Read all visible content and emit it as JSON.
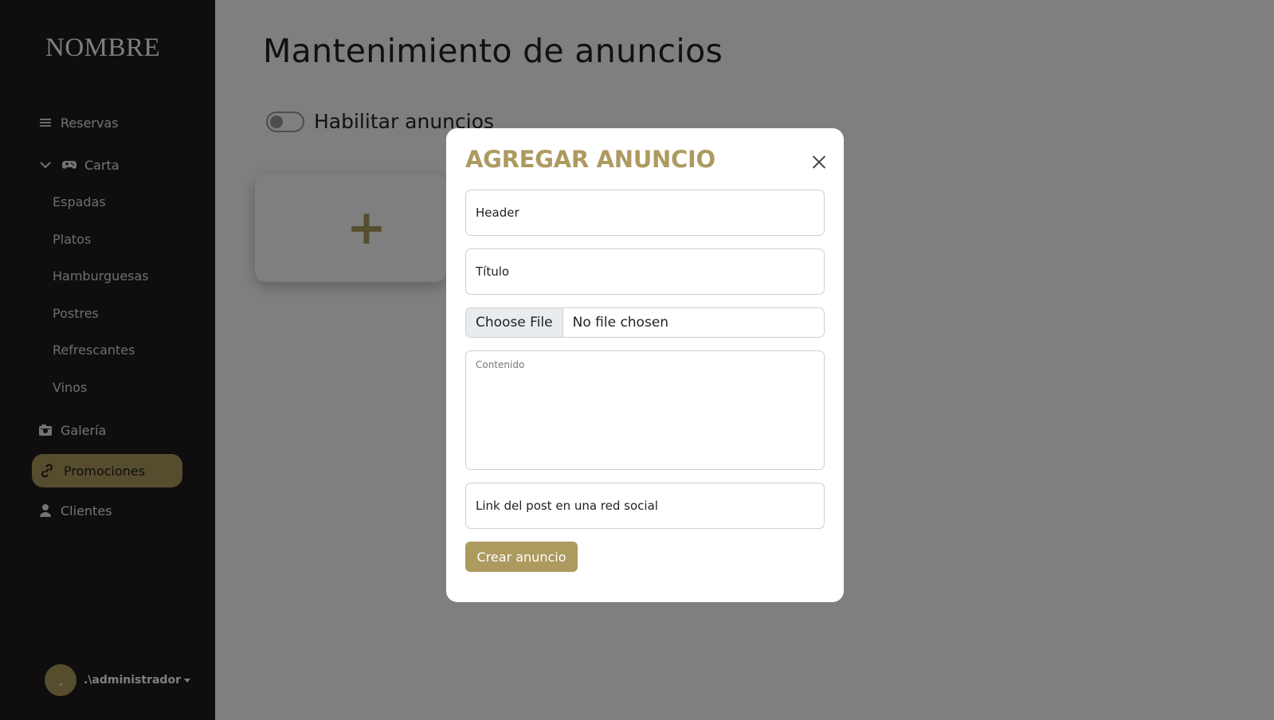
{
  "sidebar": {
    "brand": "NOMBRE",
    "items": [
      {
        "label": "Reservas",
        "icon": "list-icon"
      },
      {
        "label": "Carta",
        "icon": "gamepad-icon"
      },
      {
        "label": "Galería",
        "icon": "camera-icon"
      },
      {
        "label": "Promociones",
        "icon": "link-icon",
        "active": true
      },
      {
        "label": "Clientes",
        "icon": "user-icon"
      }
    ],
    "carta_subitems": [
      "Espadas",
      "Platos",
      "Hamburguesas",
      "Postres",
      "Refrescantes",
      "Vinos"
    ],
    "user": ".\\administrador"
  },
  "main": {
    "title": "Mantenimiento de anuncios",
    "toggle_label": "Habilitar anuncios",
    "toggle_on": false,
    "add_card_symbol": "+"
  },
  "modal": {
    "title": "AGREGAR ANUNCIO",
    "header_placeholder": "Header",
    "titulo_placeholder": "Título",
    "file_button": "Choose File",
    "file_status": "No file chosen",
    "contenido_placeholder": "Contenido",
    "link_placeholder": "Link del post en una red social",
    "submit_label": "Crear anuncio"
  },
  "colors": {
    "accent": "#ad9a5f",
    "sidebar_bg": "#1e1b1b"
  }
}
